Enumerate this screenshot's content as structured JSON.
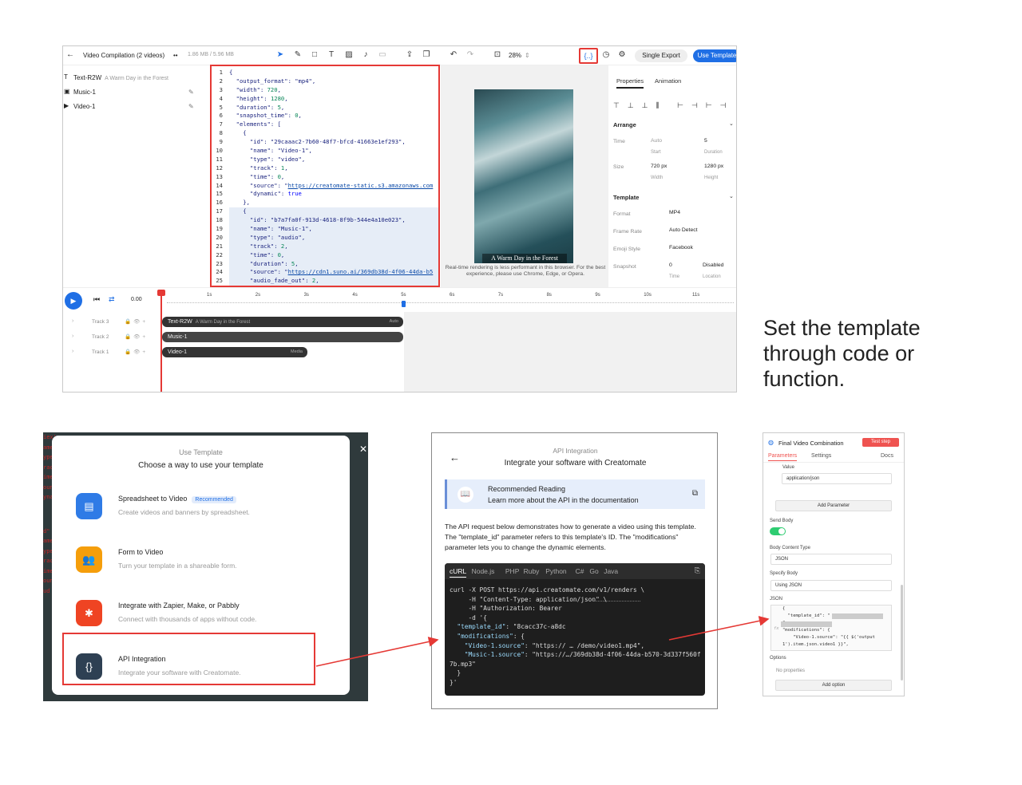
{
  "editor": {
    "title": "Video Compilation (2 videos)",
    "size_info": "1.86 MB / 5.96 MB",
    "zoom": "28%",
    "code_btn": "{..}",
    "single_export": "Single Export",
    "use_template": "Use Template",
    "layers": [
      {
        "icon": "T",
        "name": "Text-R2W",
        "sub": "A Warm Day in the Forest"
      },
      {
        "icon": "▣",
        "name": "Music-1",
        "sub": ""
      },
      {
        "icon": "▶",
        "name": "Video-1",
        "sub": ""
      }
    ],
    "preview_caption": "A Warm Day in the Forest",
    "perf_note": "Real-time rendering is less performant in this browser. For the best experience, please use Chrome, Edge, or Opera.",
    "props": {
      "tab_properties": "Properties",
      "tab_animation": "Animation",
      "arrange": "Arrange",
      "time_label": "Time",
      "time_start": "Auto",
      "time_start_sub": "Start",
      "time_duration": "5",
      "time_duration_sub": "Duration",
      "size_label": "Size",
      "width": "720 px",
      "width_sub": "Width",
      "height": "1280 px",
      "height_sub": "Height",
      "template": "Template",
      "format_label": "Format",
      "format": "MP4",
      "framerate_label": "Frame Rate",
      "framerate": "Auto Detect",
      "emoji_label": "Emoji Style",
      "emoji": "Facebook",
      "snapshot_label": "Snapshot",
      "snapshot_time": "0",
      "snapshot_time_sub": "Time",
      "snapshot_loc": "Disabled",
      "snapshot_loc_sub": "Location"
    },
    "timeline": {
      "time": "0.00",
      "ticks": [
        "1s",
        "2s",
        "3s",
        "4s",
        "5s",
        "6s",
        "7s",
        "8s",
        "9s",
        "10s",
        "11s"
      ],
      "tracks": [
        "Track 3",
        "Track 2",
        "Track 1"
      ],
      "clips": [
        {
          "name": "Text-R2W",
          "sub": "A Warm Day in the Forest",
          "right": "Auto"
        },
        {
          "name": "Music-1",
          "sub": "",
          "right": ""
        },
        {
          "name": "Video-1",
          "sub": "",
          "right": "Media"
        }
      ]
    }
  },
  "code_lines": [
    "{",
    "  \"output_format\": \"mp4\",",
    "  \"width\": 720,",
    "  \"height\": 1280,",
    "  \"duration\": 5,",
    "  \"snapshot_time\": 0,",
    "  \"elements\": [",
    "    {",
    "      \"id\": \"29caaac2-7b60-48f7-bfcd-41663e1ef293\",",
    "      \"name\": \"Video-1\",",
    "      \"type\": \"video\",",
    "      \"track\": 1,",
    "      \"time\": 0,",
    "      \"source\": \"https://creatomate-static.s3.amazonaws.com",
    "      \"dynamic\": true",
    "    },",
    "    {",
    "      \"id\": \"b7a7fa0f-913d-4618-8f9b-544e4a10e023\",",
    "      \"name\": \"Music-1\",",
    "      \"type\": \"audio\",",
    "      \"track\": 2,",
    "      \"time\": 0,",
    "      \"duration\": 5,",
    "      \"source\": \"https://cdn1.suno.ai/369db38d-4f06-44da-b5",
    "      \"audio_fade_out\": 2,"
  ],
  "caption": "Set the template through code or function.",
  "use_template_modal": {
    "title": "Use Template",
    "subtitle": "Choose a way to use your template",
    "options": [
      {
        "title": "Spreadsheet to Video",
        "badge": "Recommended",
        "desc": "Create videos and banners by spreadsheet.",
        "icon": "▤",
        "color": "#2f7be6"
      },
      {
        "title": "Form to Video",
        "badge": "",
        "desc": "Turn your template in a shareable form.",
        "icon": "👥",
        "color": "#f59e0b"
      },
      {
        "title": "Integrate with Zapier, Make, or Pabbly",
        "badge": "",
        "desc": "Connect with thousands of apps without code.",
        "icon": "✱",
        "color": "#ef4423"
      },
      {
        "title": "API Integration",
        "badge": "",
        "desc": "Integrate your software with Creatomate.",
        "icon": "{}",
        "color": "#2e4053"
      }
    ]
  },
  "api_panel": {
    "title": "API Integration",
    "subtitle": "Integrate your software with Creatomate",
    "reading_title": "Recommended Reading",
    "reading_desc": "Learn more about the API in the documentation",
    "desc": "The API request below demonstrates how to generate a video using this template. The \"template_id\" parameter refers to this template's ID. The \"modifications\" parameter lets you to change the dynamic elements.",
    "langs": [
      "cURL",
      "Node.js",
      "PHP",
      "Ruby",
      "Python",
      "C#",
      "Go",
      "Java"
    ],
    "curl": [
      "curl -X POST https://api.creatomate.com/v1/renders \\",
      "     -H \"Content-Type: application/json\" \\",
      "     -H \"Authorization: Bearer ",
      "     -d '{",
      "  \"template_id\": \"8cacc37c-a8dc",
      "  \"modifications\": {",
      "    \"Video-1.source\": \"https:// … /demo/video1.mp4\",",
      "    \"Music-1.source\": \"https://…/369db38d-4f06-44da-b570-3d337f560f",
      "7b.mp3\"",
      "  }",
      "}'"
    ]
  },
  "n8n_panel": {
    "title": "Final Video Combination",
    "test_step": "Test step",
    "tab_parameters": "Parameters",
    "tab_settings": "Settings",
    "docs": "Docs",
    "value_label": "Value",
    "value": "application/json",
    "add_parameter": "Add Parameter",
    "send_body": "Send Body",
    "body_content_type_label": "Body Content Type",
    "body_content_type": "JSON",
    "specify_body_label": "Specify Body",
    "specify_body": "Using JSON",
    "json_label": "JSON",
    "json_lines": [
      "{",
      "  \"template_id\": \"",
      "\",",
      "\"modifications\": {",
      "    \"Video-1.source\": \"{{ $('output",
      "1').item.json.video1 }}\","
    ],
    "options_label": "Options",
    "no_properties": "No properties",
    "add_option": "Add option"
  }
}
